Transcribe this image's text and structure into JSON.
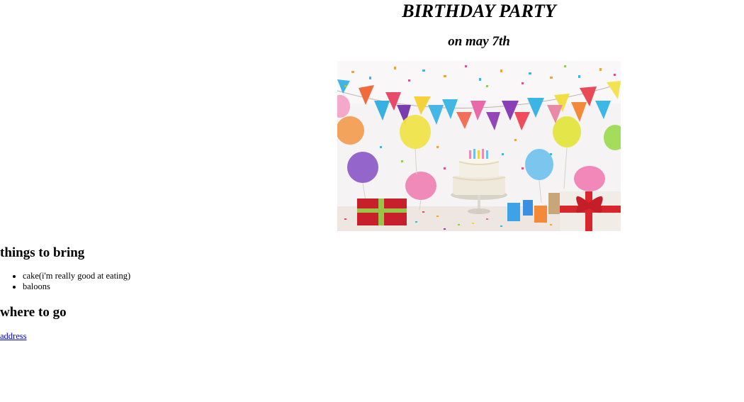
{
  "header": {
    "title": "BIRTHDAY PARTY",
    "subtitle": "on may 7th"
  },
  "image": {
    "subject": "birthday-party-photo",
    "colors": {
      "wall": "#f4f1f3",
      "cake": "#efe9dc",
      "gift_red": "#c8202a",
      "ribbon": "#d8262c"
    }
  },
  "things_to_bring": {
    "heading": "things to bring",
    "items": [
      "cake(i'm really good at eating)",
      "baloons"
    ]
  },
  "where_to_go": {
    "heading": "where to go",
    "link_text": "address"
  }
}
